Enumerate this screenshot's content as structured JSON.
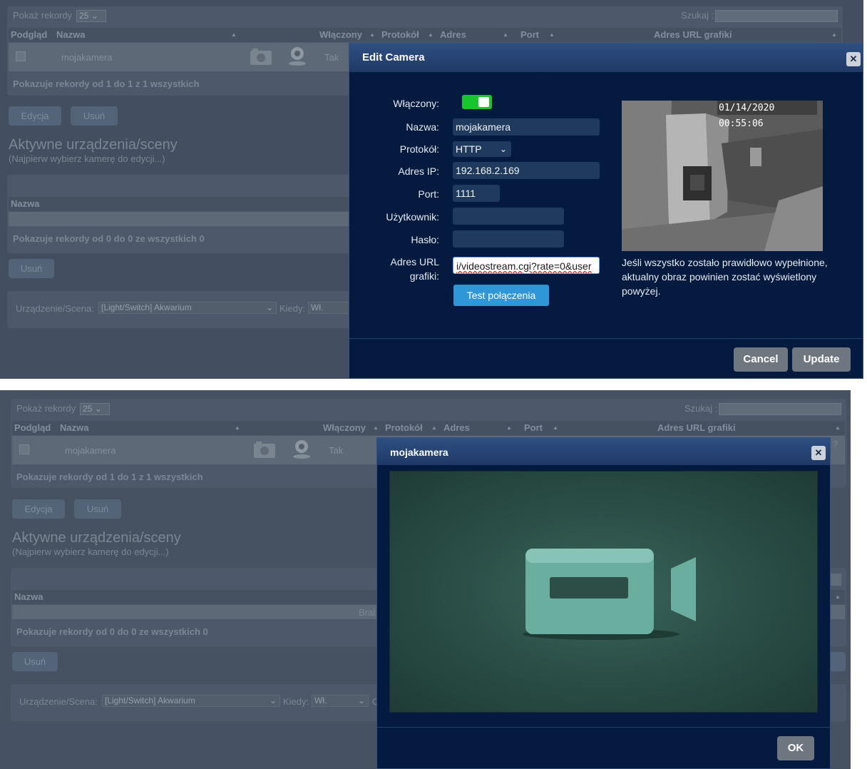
{
  "background": {
    "show_records_label": "Pokaż rekordy",
    "show_records_value": "25",
    "search_label": "Szukaj :",
    "columns": [
      "Podgląd",
      "Nazwa",
      "Włączony",
      "Protokół",
      "Adres",
      "Port",
      "Adres URL grafiki"
    ],
    "row": {
      "name": "mojakamera",
      "enabled": "Tak"
    },
    "info_1": "Pokazuje rekordy od 1 do 1 z 1 wszystkich",
    "edit_button": "Edycja",
    "delete_button": "Usuń",
    "section_title": "Aktywne urządzenia/sceny",
    "section_subtitle": "(Najpierw wybierz kamerę do edycji...)",
    "table2_col": "Nazwa",
    "info_2": "Pokazuje rekordy od 0 do 0 ze wszystkich 0",
    "delete_button_2": "Usuń",
    "device_label": "Urządzenie/Scena:",
    "device_value": "[Light/Switch] Akwarium",
    "when_label": "Kiedy:",
    "when_value": "Wł.",
    "partial_bral": "Bral",
    "partial_q": "?",
    "partial_o": "O"
  },
  "edit_dialog": {
    "title": "Edit Camera",
    "enabled_label": "Włączony:",
    "name_label": "Nazwa:",
    "name_value": "mojakamera",
    "protocol_label": "Protokół:",
    "protocol_value": "HTTP",
    "ip_label": "Adres IP:",
    "ip_value": "192.168.2.169",
    "port_label": "Port:",
    "port_value": "1111",
    "user_label": "Użytkownik:",
    "user_value": "",
    "password_label": "Hasło:",
    "password_value": "",
    "url_label": "Adres URL grafiki:",
    "url_value": "i/videostream.cgi?rate=0&user",
    "test_button": "Test połączenia",
    "timestamp": "01/14/2020 00:55:06",
    "hint": "Jeśli wszystko zostało prawidłowo wypełnione, aktualny obraz powinien zostać wyświetlony powyżej.",
    "cancel_button": "Cancel",
    "update_button": "Update"
  },
  "view_dialog": {
    "title": "mojakamera",
    "ok_button": "OK"
  },
  "colors": {
    "toggle_on": "#19c52c",
    "test_button": "#2f96d8",
    "dialog_bg": "#041a3e",
    "dialog_title": "#2a4a7e",
    "video_bg": "#24433d",
    "video_icon": "#6aaea0"
  }
}
